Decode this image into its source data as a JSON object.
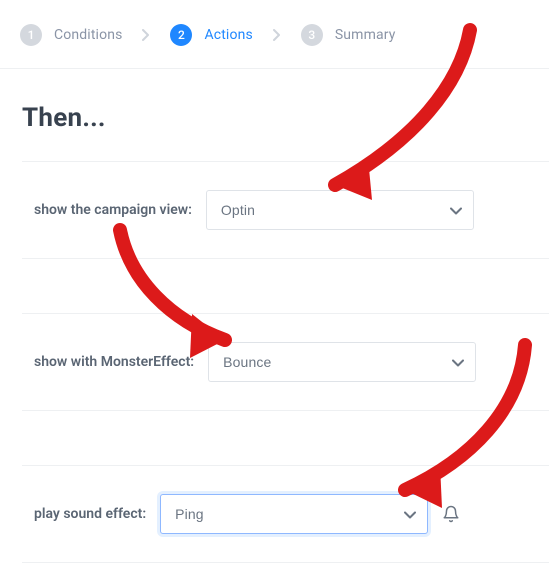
{
  "stepper": {
    "steps": [
      {
        "num": "1",
        "label": "Conditions",
        "current": false
      },
      {
        "num": "2",
        "label": "Actions",
        "current": true
      },
      {
        "num": "3",
        "label": "Summary",
        "current": false
      }
    ]
  },
  "heading": "Then...",
  "rules": [
    {
      "label": "show the campaign view:",
      "select_width": "w-lg",
      "value": "Optin"
    },
    {
      "label": "show with MonsterEffect:",
      "select_width": "w-lg",
      "value": "Bounce"
    },
    {
      "label": "play sound effect:",
      "select_width": "w-md",
      "value": "Ping",
      "focused": true,
      "trailing_icon": "bell"
    }
  ],
  "colors": {
    "accent": "#1f87ff",
    "annotation": "#dc1a1a"
  }
}
